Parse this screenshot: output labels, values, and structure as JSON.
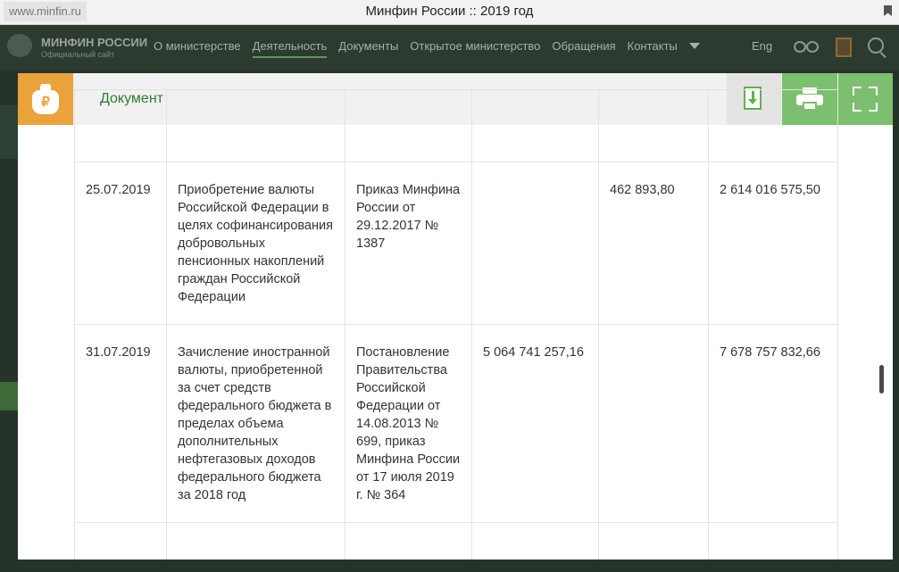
{
  "browser": {
    "url": "www.minfin.ru",
    "tab_title": "Минфин России :: 2019 год"
  },
  "site": {
    "logo_title": "МИНФИН РОССИИ",
    "logo_subtitle": "Официальный сайт",
    "nav": [
      "О министерстве",
      "Деятельность",
      "Документы",
      "Открытое министерство",
      "Обращения",
      "Контакты"
    ],
    "language": "Eng"
  },
  "modal": {
    "title": "Документ",
    "logo_symbol": "₽",
    "colors": {
      "logo_bg": "#eaa33a",
      "button_green": "#7cbf6e",
      "title_green": "#2e7d32"
    }
  },
  "table": {
    "rows": [
      [
        "",
        "",
        "",
        "",
        "",
        ""
      ],
      [
        "25.07.2019",
        "Приобретение валюты Российской Федерации в целях софинансирования добровольных пенсионных накоплений граждан Российской Федерации",
        "Приказ Минфина России от 29.12.2017 № 1387",
        "",
        "462 893,80",
        "2 614 016 575,50"
      ],
      [
        "31.07.2019",
        "Зачисление иностранной валюты, приобретенной за счет средств федерального бюджета в пределах объема дополнительных нефтегазовых доходов федерального бюджета за 2018 год",
        "Постановление Правительства Российской Федерации от 14.08.2013 № 699, приказ Минфина России от 17 июля 2019 г. № 364",
        "5 064 741 257,16",
        "",
        "7 678 757 832,66"
      ],
      [
        "",
        "",
        "",
        "",
        "",
        ""
      ]
    ]
  }
}
